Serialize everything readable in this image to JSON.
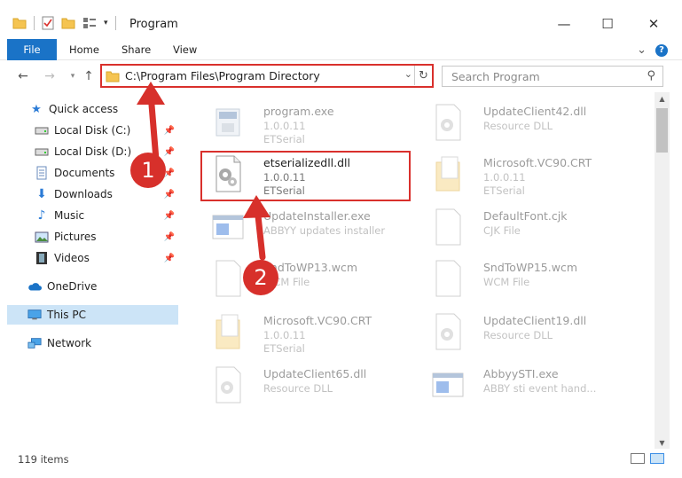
{
  "window": {
    "title": "Program",
    "minimize_glyph": "—",
    "maximize_glyph": "☐",
    "close_glyph": "✕"
  },
  "ribbon": {
    "tabs": [
      "File",
      "Home",
      "Share",
      "View"
    ],
    "collapse_glyph": "⌄",
    "help_glyph": "?"
  },
  "address_bar": {
    "path": "C:\\Program Files\\Program Directory",
    "search_placeholder": "Search Program"
  },
  "sidebar": {
    "items": [
      {
        "label": "Quick access",
        "icon": "star-icon",
        "pinned": false
      },
      {
        "label": "Local Disk (C:)",
        "icon": "drive-icon",
        "pinned": true
      },
      {
        "label": "Local Disk (D:)",
        "icon": "drive-icon",
        "pinned": true
      },
      {
        "label": "Documents",
        "icon": "documents-icon",
        "pinned": true
      },
      {
        "label": "Downloads",
        "icon": "download-icon",
        "pinned": true
      },
      {
        "label": "Music",
        "icon": "music-icon",
        "pinned": true
      },
      {
        "label": "Pictures",
        "icon": "pictures-icon",
        "pinned": true
      },
      {
        "label": "Videos",
        "icon": "videos-icon",
        "pinned": true
      },
      {
        "label": "OneDrive",
        "icon": "cloud-icon",
        "pinned": false
      },
      {
        "label": "This PC",
        "icon": "computer-icon",
        "pinned": false,
        "selected": true
      },
      {
        "label": "Network",
        "icon": "network-icon",
        "pinned": false
      }
    ]
  },
  "files": [
    {
      "name": "program.exe",
      "line2": "1.0.0.11",
      "line3": "ETSerial",
      "icon": "exe"
    },
    {
      "name": "UpdateClient42.dll",
      "line2": "Resource DLL",
      "line3": "",
      "icon": "dll"
    },
    {
      "name": "etserializedll.dll",
      "line2": "1.0.0.11",
      "line3": "ETSerial",
      "icon": "dll",
      "highlighted": true
    },
    {
      "name": "Microsoft.VC90.CRT",
      "line2": "1.0.0.11",
      "line3": "ETSerial",
      "icon": "folder-doc"
    },
    {
      "name": "UpdateInstaller.exe",
      "line2": "ABBYY updates installer",
      "line3": "",
      "icon": "exe-window"
    },
    {
      "name": "DefaultFont.cjk",
      "line2": "CJK File",
      "line3": "",
      "icon": "blank"
    },
    {
      "name": "SndToWP13.wcm",
      "line2": "WCM File",
      "line3": "",
      "icon": "blank"
    },
    {
      "name": "SndToWP15.wcm",
      "line2": "WCM File",
      "line3": "",
      "icon": "blank"
    },
    {
      "name": "Microsoft.VC90.CRT",
      "line2": "1.0.0.11",
      "line3": "ETSerial",
      "icon": "folder-doc"
    },
    {
      "name": "UpdateClient19.dll",
      "line2": "Resource DLL",
      "line3": "",
      "icon": "dll"
    },
    {
      "name": "UpdateClient65.dll",
      "line2": "Resource DLL",
      "line3": "",
      "icon": "dll"
    },
    {
      "name": "AbbyySTI.exe",
      "line2": "ABBY sti event hand...",
      "line3": "",
      "icon": "exe-window"
    }
  ],
  "status": {
    "item_count": "119 items"
  },
  "annotations": {
    "step1": "1",
    "step2": "2"
  },
  "colors": {
    "annotation_red": "#d7302b",
    "accent_blue": "#1a73c7",
    "selection_blue": "#cce4f7"
  }
}
